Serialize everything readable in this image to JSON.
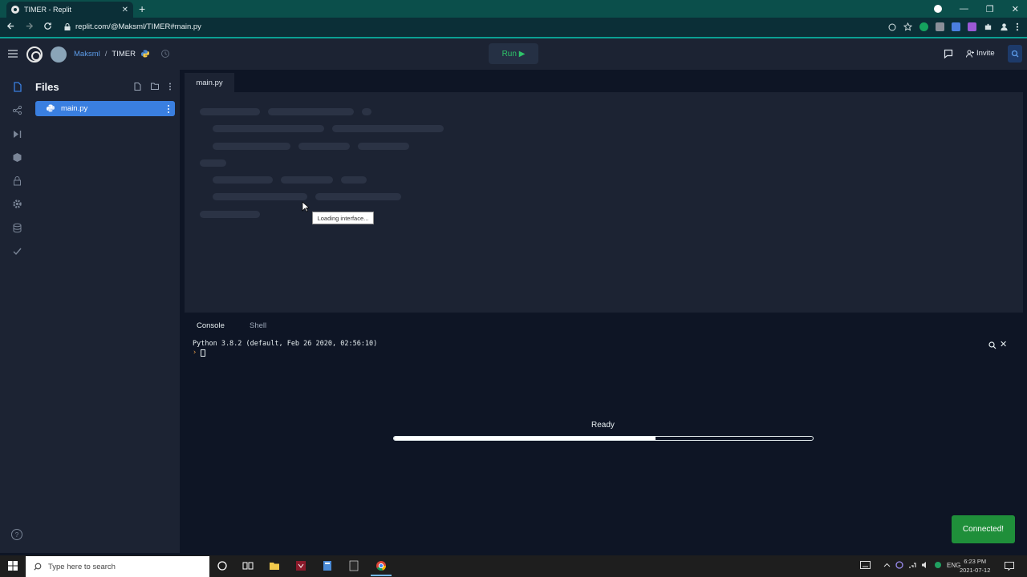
{
  "browser": {
    "tab_title": "TIMER - Replit",
    "tab_close": "✕",
    "new_tab": "+",
    "url": "replit.com/@Maksml/TIMER#main.py",
    "win_minimize": "—",
    "win_restore": "❐",
    "win_close": "✕"
  },
  "header": {
    "username": "Maksml",
    "separator": "/",
    "project": "TIMER",
    "run_label": "Run ▶",
    "invite_label": "Invite"
  },
  "files": {
    "title": "Files",
    "items": [
      {
        "label": "main.py"
      }
    ]
  },
  "editor": {
    "tab": "main.py",
    "tooltip": "Loading interface..."
  },
  "console": {
    "tabs": [
      {
        "label": "Console"
      },
      {
        "label": "Shell"
      }
    ],
    "python_version": "Python 3.8.2 (default, Feb 26 2020, 02:56:10)",
    "prompt": "›",
    "close": "✕",
    "status": "Ready",
    "progress": 0.625,
    "toast": "Connected!"
  },
  "taskbar": {
    "search_placeholder": "Type here to search",
    "lang": "ENG",
    "time": "6:23 PM",
    "date": "2021-07-12"
  },
  "colors": {
    "accent": "#0aa193",
    "run_green": "#2ec46a",
    "file_selected": "#3a7fe0",
    "toast_green": "#1f8f3a"
  }
}
